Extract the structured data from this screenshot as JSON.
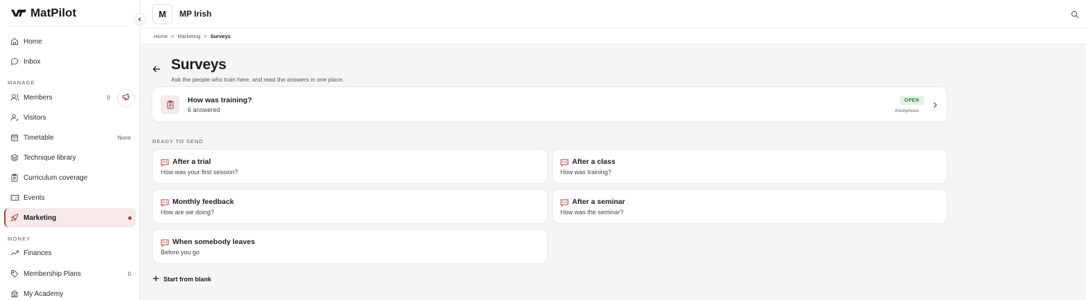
{
  "app": {
    "name": "MatPilot"
  },
  "sidebar": {
    "items": [
      {
        "label": "Home"
      },
      {
        "label": "Inbox"
      },
      {
        "label": "Members",
        "count": "0"
      },
      {
        "label": "Visitors"
      },
      {
        "label": "Timetable",
        "count": "None"
      },
      {
        "label": "Technique library"
      },
      {
        "label": "Curriculum coverage"
      },
      {
        "label": "Events"
      },
      {
        "label": "Marketing"
      },
      {
        "label": "Finances"
      },
      {
        "label": "Membership Plans",
        "count": "0"
      },
      {
        "label": "My Academy"
      }
    ],
    "sections": {
      "manage": "MANAGE",
      "money": "MONEY"
    }
  },
  "topbar": {
    "org_initial": "M",
    "org_name": "MP Irish"
  },
  "breadcrumb": {
    "home": "Home",
    "marketing": "Marketing",
    "current": "Surveys"
  },
  "page": {
    "title": "Surveys",
    "subtitle": "Ask the people who train here, and read the answers in one place."
  },
  "active_survey": {
    "title": "How was training?",
    "answered": "6 answered",
    "status": "OPEN",
    "visibility": "Anonymous"
  },
  "ready": {
    "label": "READY TO SEND",
    "templates": [
      {
        "title": "After a trial",
        "desc": "How was your first session?"
      },
      {
        "title": "After a class",
        "desc": "How was training?"
      },
      {
        "title": "Monthly feedback",
        "desc": "How are we doing?"
      },
      {
        "title": "After a seminar",
        "desc": "How was the seminar?"
      },
      {
        "title": "When somebody leaves",
        "desc": "Before you go"
      }
    ]
  },
  "actions": {
    "start_blank": "Start from blank"
  },
  "colors": {
    "accent": "#a4403f",
    "accent_bg": "#f6e9e9",
    "open_green": "#2f7d3b",
    "page_bg": "#f6f5f4"
  },
  "icons": [
    "matpilot-logo-icon",
    "chevron-left-icon",
    "home-icon",
    "inbox-icon",
    "members-icon",
    "visitors-icon",
    "calendar-icon",
    "layers-icon",
    "clipboard-icon",
    "ticket-icon",
    "rocket-icon",
    "trend-icon",
    "tag-icon",
    "academy-icon",
    "megaphone-icon",
    "search-icon",
    "back-arrow-icon",
    "chevron-right-icon",
    "message-icon",
    "plus-icon"
  ]
}
